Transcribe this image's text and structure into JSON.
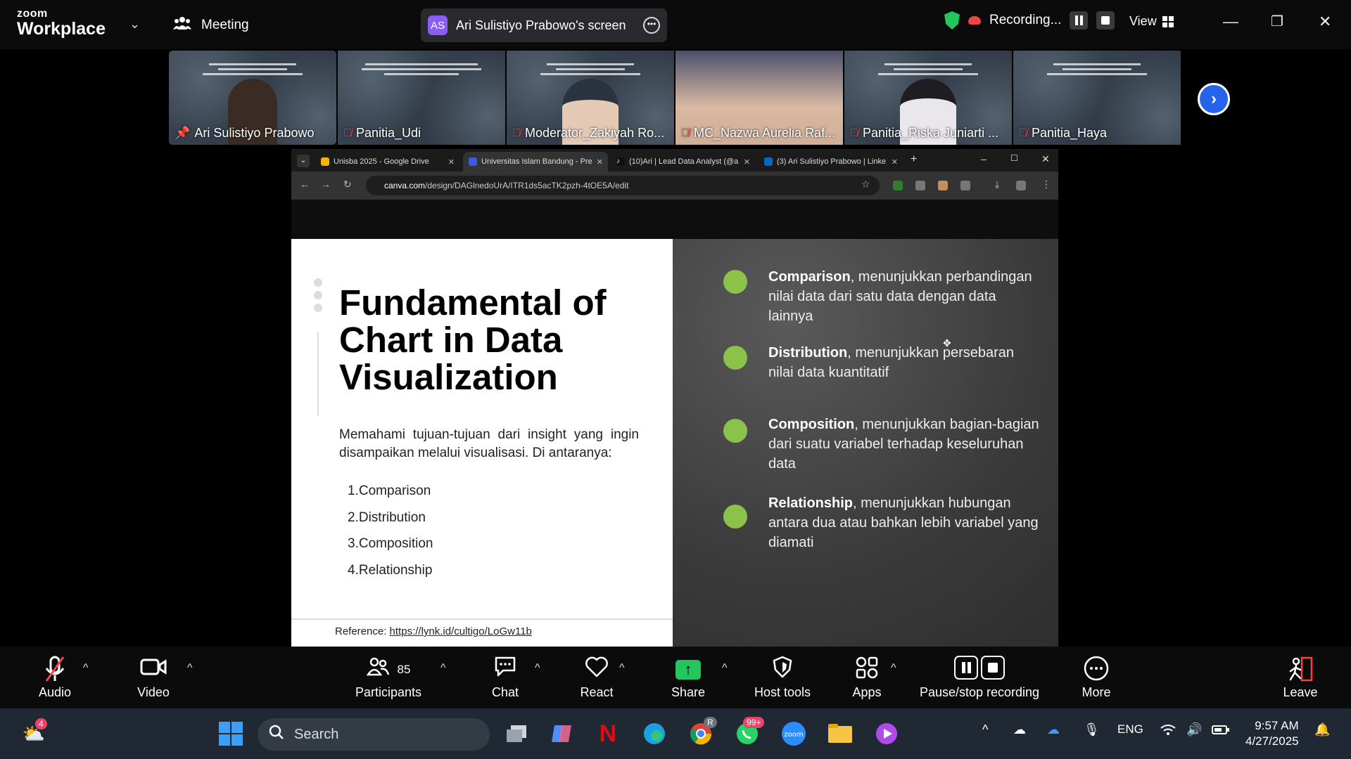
{
  "app": {
    "brand_top": "zoom",
    "brand_name": "Workplace",
    "meeting_label": "Meeting"
  },
  "share_pill": {
    "avatar": "AS",
    "text": "Ari Sulistiyo Prabowo's screen"
  },
  "recording": {
    "label": "Recording..."
  },
  "view": {
    "label": "View"
  },
  "participants": [
    {
      "name": "Ari Sulistiyo Prabowo",
      "pinned": true,
      "muted": false
    },
    {
      "name": "Panitia_Udi",
      "muted": true
    },
    {
      "name": "Moderator_Zakiyah Ro...",
      "muted": true
    },
    {
      "name": "MC_Nazwa Aurelia Raf...",
      "muted": true
    },
    {
      "name": "Panitia_Riska Juniarti ...",
      "muted": true
    },
    {
      "name": "Panitia_Haya",
      "muted": true
    }
  ],
  "browser": {
    "tabs": [
      {
        "title": "Unisba 2025 - Google Drive",
        "color": "#f4b400"
      },
      {
        "title": "Universitas Islam Bandung - Pre",
        "color": "#3b5bdb",
        "current": true
      },
      {
        "title": "(10)Ari | Lead Data Analyst (@a",
        "color": "#ffffff"
      },
      {
        "title": "(3) Ari Sulistiyo Prabowo | Linke",
        "color": "#0a66c2"
      }
    ],
    "url_host": "canva.com",
    "url_path": "/design/DAGlnedoUrA/ITR1ds5acTK2pzh-4tOE5A/edit"
  },
  "slide": {
    "title": "Fundamental of Chart in Data Visualization",
    "intro": "Memahami tujuan-tujuan dari insight yang ingin disampaikan melalui visualisasi. Di antaranya:",
    "list": [
      "1.Comparison",
      "2.Distribution",
      "3.Composition",
      "4.Relationship"
    ],
    "reference_label": "Reference:",
    "reference_link": "https://lynk.id/cultigo/LoGw11b",
    "points": [
      {
        "term": "Comparison",
        "desc": ", menunjukkan perbandingan nilai data dari satu data dengan data lainnya"
      },
      {
        "term": "Distribution",
        "desc": ", menunjukkan persebaran nilai data kuantitatif"
      },
      {
        "term": "Composition",
        "desc": ", menunjukkan bagian-bagian dari suatu variabel terhadap keseluruhan data"
      },
      {
        "term": "Relationship",
        "desc": ", menunjukkan hubungan antara dua atau bahkan lebih variabel yang diamati"
      }
    ],
    "bullet_color": "#8bc34a"
  },
  "toolbar": {
    "audio": "Audio",
    "video": "Video",
    "participants": "Participants",
    "participants_count": "85",
    "chat": "Chat",
    "react": "React",
    "share": "Share",
    "host_tools": "Host tools",
    "apps": "Apps",
    "pause_stop": "Pause/stop recording",
    "more": "More",
    "leave": "Leave"
  },
  "taskbar": {
    "weather_badge": "4",
    "search_placeholder": "Search",
    "whatsapp_badge": "99+",
    "chrome_badge": "R",
    "lang": "ENG",
    "time": "9:57 AM",
    "date": "4/27/2025"
  }
}
